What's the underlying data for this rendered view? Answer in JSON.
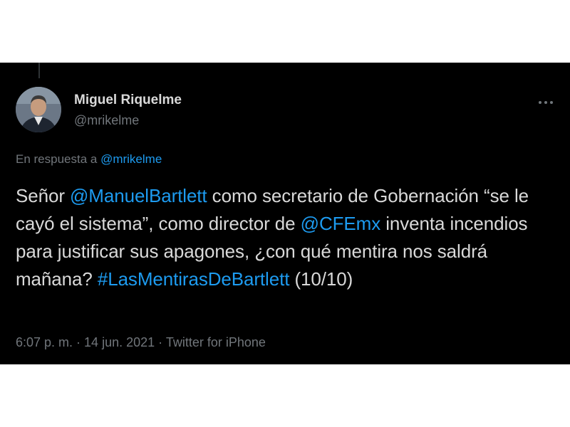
{
  "author": {
    "display_name": "Miguel Riquelme",
    "handle": "@mrikelme",
    "avatar_icon": "profile-photo"
  },
  "more_icon": "more-options-icon",
  "reply": {
    "prefix": "En respuesta a ",
    "mention": "@mrikelme"
  },
  "tweet": {
    "t1": "Señor ",
    "mention1": "@ManuelBartlett",
    "t2": " como secretario de Gobernación “se le cayó el sistema”, como director de ",
    "mention2": "@CFEmx",
    "t3": " inventa incendios para justificar sus apagones, ¿con qué mentira nos saldrá mañana? ",
    "hashtag": "#LasMentirasDeBartlett",
    "t4": " (10/10)"
  },
  "meta": {
    "time": "6:07 p. m.",
    "sep1": " · ",
    "date": "14 jun. 2021",
    "sep2": " · ",
    "source": "Twitter for iPhone"
  },
  "colors": {
    "background": "#000000",
    "text": "#d9d9d9",
    "link": "#1d9bf0",
    "secondary": "#71767b"
  }
}
